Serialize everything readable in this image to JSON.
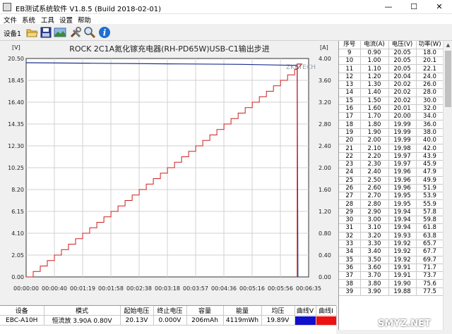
{
  "window": {
    "title": "EB测试系统软件 V1.8.5 (Build 2018-02-01)",
    "min": "—",
    "max": "☐",
    "close": "✕"
  },
  "menu": [
    "文件",
    "系统",
    "工具",
    "设置",
    "帮助"
  ],
  "toolbar": {
    "device_label": "设备1",
    "buttons": [
      "folder-open-icon",
      "save-icon",
      "chart-image-icon",
      "tools-icon",
      "zoom-icon",
      "info-icon"
    ]
  },
  "colors": {
    "voltage": "#1c2f8c",
    "current": "#cc1e1e",
    "swatch_v": "#1010cc",
    "swatch_i": "#ee1111"
  },
  "chart_data": {
    "type": "line",
    "title": "ROCK 2C1A氮化镓充电器(RH-PD65W)USB-C1输出步进",
    "left_unit": "[V]",
    "right_unit": "[A]",
    "annotation": "ZKETECH",
    "y_left_ticks": [
      "20.50",
      "18.45",
      "16.40",
      "14.35",
      "12.30",
      "10.25",
      "8.20",
      "6.15",
      "4.10",
      "2.05",
      "0.00"
    ],
    "y_right_ticks": [
      "4.00",
      "3.60",
      "3.20",
      "2.80",
      "2.40",
      "2.00",
      "1.60",
      "1.20",
      "0.80",
      "0.40",
      "0.00"
    ],
    "x_ticks": [
      "00:00:00",
      "00:00:40",
      "00:01:19",
      "00:01:58",
      "00:02:38",
      "00:03:18",
      "00:03:57",
      "00:04:36",
      "00:05:16",
      "00:05:56",
      "00:06:35"
    ],
    "ylim_left": [
      0,
      20.5
    ],
    "ylim_right": [
      0,
      4.0
    ],
    "xlim_seconds": [
      0,
      395
    ],
    "series": [
      {
        "axis": "left",
        "color": "#1c2f8c",
        "x": [
          0,
          100,
          200,
          300,
          378,
          379,
          380
        ],
        "y": [
          20.1,
          20.05,
          20.0,
          19.95,
          19.85,
          19.8,
          0.0
        ]
      },
      {
        "axis": "right",
        "color": "#cc1e1e",
        "step": true,
        "x_start": 0,
        "x_step": 9.88,
        "x_end": 379,
        "y": [
          0.0,
          0.1,
          0.2,
          0.3,
          0.4,
          0.5,
          0.6,
          0.7,
          0.8,
          0.9,
          1.0,
          1.1,
          1.2,
          1.3,
          1.4,
          1.5,
          1.6,
          1.7,
          1.8,
          1.9,
          2.0,
          2.1,
          2.2,
          2.3,
          2.4,
          2.5,
          2.6,
          2.7,
          2.8,
          2.9,
          3.0,
          3.1,
          3.2,
          3.3,
          3.4,
          3.5,
          3.6,
          3.7,
          3.8,
          3.9
        ],
        "drop_to": 0.0
      }
    ]
  },
  "side_table": {
    "headers": [
      "序号",
      "电流(A)",
      "电压(V)",
      "功率(W)"
    ],
    "rows": [
      [
        "9",
        "0.90",
        "20.05",
        "18.0"
      ],
      [
        "10",
        "1.00",
        "20.05",
        "20.1"
      ],
      [
        "11",
        "1.10",
        "20.05",
        "22.1"
      ],
      [
        "12",
        "1.20",
        "20.04",
        "24.0"
      ],
      [
        "13",
        "1.30",
        "20.02",
        "26.0"
      ],
      [
        "14",
        "1.40",
        "20.02",
        "28.0"
      ],
      [
        "15",
        "1.50",
        "20.02",
        "30.0"
      ],
      [
        "16",
        "1.60",
        "20.01",
        "32.0"
      ],
      [
        "17",
        "1.70",
        "20.00",
        "34.0"
      ],
      [
        "18",
        "1.80",
        "19.99",
        "36.0"
      ],
      [
        "19",
        "1.90",
        "19.99",
        "38.0"
      ],
      [
        "20",
        "2.00",
        "19.99",
        "40.0"
      ],
      [
        "21",
        "2.10",
        "19.98",
        "42.0"
      ],
      [
        "22",
        "2.20",
        "19.97",
        "43.9"
      ],
      [
        "23",
        "2.30",
        "19.97",
        "45.9"
      ],
      [
        "24",
        "2.40",
        "19.96",
        "47.9"
      ],
      [
        "25",
        "2.50",
        "19.96",
        "49.9"
      ],
      [
        "26",
        "2.60",
        "19.96",
        "51.9"
      ],
      [
        "27",
        "2.70",
        "19.95",
        "53.9"
      ],
      [
        "28",
        "2.80",
        "19.95",
        "55.9"
      ],
      [
        "29",
        "2.90",
        "19.94",
        "57.8"
      ],
      [
        "30",
        "3.00",
        "19.94",
        "59.8"
      ],
      [
        "31",
        "3.10",
        "19.94",
        "61.8"
      ],
      [
        "32",
        "3.20",
        "19.93",
        "63.8"
      ],
      [
        "33",
        "3.30",
        "19.92",
        "65.7"
      ],
      [
        "34",
        "3.40",
        "19.92",
        "67.7"
      ],
      [
        "35",
        "3.50",
        "19.92",
        "69.7"
      ],
      [
        "36",
        "3.60",
        "19.91",
        "71.7"
      ],
      [
        "37",
        "3.70",
        "19.91",
        "73.7"
      ],
      [
        "38",
        "3.80",
        "19.90",
        "75.6"
      ],
      [
        "39",
        "3.90",
        "19.88",
        "77.5"
      ]
    ]
  },
  "bottom_table": {
    "headers": [
      "设备",
      "模式",
      "起始电压",
      "终止电压",
      "容量",
      "能量",
      "均压",
      "曲线V",
      "曲线I"
    ],
    "row": [
      "EBC-A10H",
      "恒流放  3.90A  0.80V",
      "20.13V",
      "0.000V",
      "206mAh",
      "4119mWh",
      "19.89V",
      "",
      ""
    ]
  },
  "watermark": "SMYZ.NET"
}
